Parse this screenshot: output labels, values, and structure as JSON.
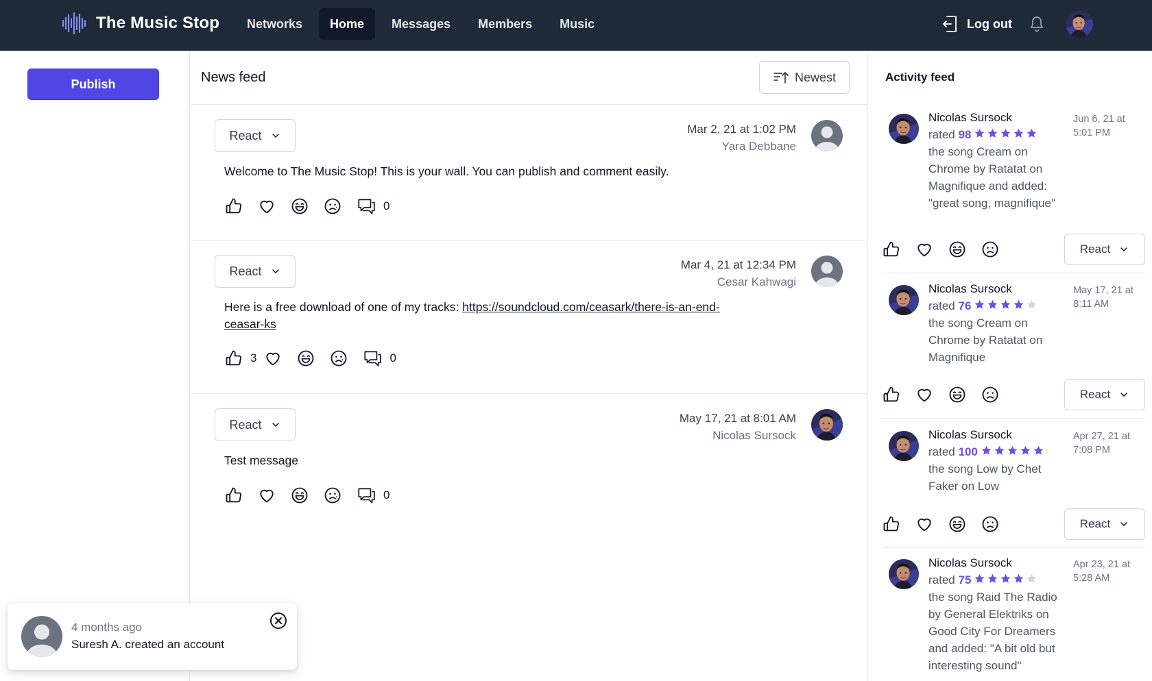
{
  "app": {
    "title": "The Music Stop"
  },
  "nav": {
    "links": [
      {
        "label": "Networks",
        "active": false
      },
      {
        "label": "Home",
        "active": true
      },
      {
        "label": "Messages",
        "active": false
      },
      {
        "label": "Members",
        "active": false
      },
      {
        "label": "Music",
        "active": false
      }
    ],
    "logout_label": "Log out"
  },
  "sidebar": {
    "publish_label": "Publish"
  },
  "feed": {
    "title": "News feed",
    "sort_label": "Newest",
    "posts": [
      {
        "react_label": "React",
        "date": "Mar 2, 21 at 1:02 PM",
        "author": "Yara Debbane",
        "text": "Welcome to The Music Stop! This is your wall. You can publish and comment easily.",
        "like_count": "",
        "comment_count": "0"
      },
      {
        "react_label": "React",
        "date": "Mar 4, 21 at 12:34 PM",
        "author": "Cesar Kahwagi",
        "text": "Here is a free download of one of my tracks: ",
        "link": "https://soundcloud.com/ceasark/there-is-an-end-ceasar-ks",
        "like_count": "3",
        "comment_count": "0"
      },
      {
        "react_label": "React",
        "date": "May 17, 21 at 8:01 AM",
        "author": "Nicolas Sursock",
        "text": "Test message",
        "like_count": "",
        "comment_count": "0"
      }
    ]
  },
  "activity": {
    "title": "Activity feed",
    "items": [
      {
        "name": "Nicolas Sursock",
        "rated_word": "rated",
        "rating": "98",
        "stars": 5,
        "text": "the song Cream on Chrome by Ratatat on Magnifique and added: \"great song, magnifique\"",
        "time": "Jun 6, 21 at 5:01 PM",
        "react_label": "React"
      },
      {
        "name": "Nicolas Sursock",
        "rated_word": "rated",
        "rating": "76",
        "stars": 4,
        "text": "the song Cream on Chrome by Ratatat on Magnifique",
        "time": "May 17, 21 at 8:11 AM",
        "react_label": "React"
      },
      {
        "name": "Nicolas Sursock",
        "rated_word": "rated",
        "rating": "100",
        "stars": 5,
        "text": "the song Low by Chet Faker on Low",
        "time": "Apr 27, 21 at 7:08 PM",
        "react_label": "React"
      },
      {
        "name": "Nicolas Sursock",
        "rated_word": "rated",
        "rating": "75",
        "stars": 4,
        "text": "the song Raid The Radio by General Elektriks on Good City For Dreamers and added: \"A bit old but interesting sound\"",
        "time": "Apr 23, 21 at 5:28 AM",
        "react_label": "React"
      }
    ]
  },
  "toast": {
    "time": "4 months ago",
    "message": "Suresh A. created an account"
  },
  "colors": {
    "nav_bg": "#1f2937",
    "accent": "#4f46e5",
    "rating": "#6d4ee6",
    "star_empty": "#d1d5db"
  },
  "icons": [
    "waveform-logo-icon",
    "logout-icon",
    "bell-icon",
    "sort-icon",
    "chevron-down-icon",
    "thumbs-up-icon",
    "heart-icon",
    "laugh-icon",
    "sad-icon",
    "comments-icon",
    "star-icon",
    "close-circle-icon"
  ]
}
